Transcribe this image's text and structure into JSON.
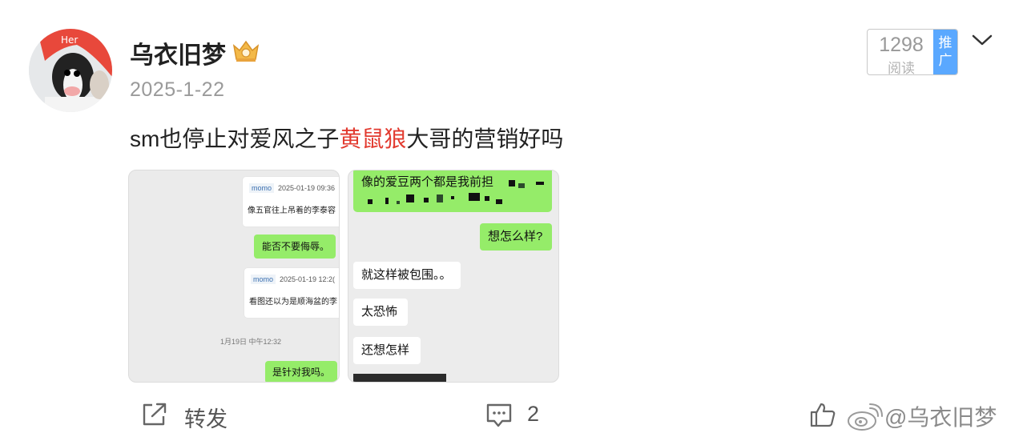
{
  "post": {
    "username": "乌衣旧梦",
    "date": "2025-1-22",
    "views": {
      "count": "1298",
      "label": "阅读",
      "promo": [
        "推",
        "广"
      ]
    },
    "text_before": "sm也停止对爱风之子",
    "text_highlight": "黄鼠狼",
    "text_after": "大哥的营销好吗",
    "highlight_color": "#e23a2f"
  },
  "image1": {
    "card1": {
      "user": "momo",
      "date": "2025-01-19 09:36",
      "text": "像五官往上吊着的李泰容"
    },
    "bubble1": "能否不要侮辱。",
    "card2": {
      "user": "momo",
      "date": "2025-01-19 12:2(",
      "text": "看图还以为是顺海盆的李"
    },
    "timestamp": "1月19日 中午12:32",
    "bubble2": "是针对我吗。"
  },
  "image2": {
    "bubble_top": "像的爱豆两个都是我前担",
    "bubble_right": "想怎么样?",
    "left_bubbles": [
      "就这样被包围。。",
      "太恐怖",
      "还想怎样"
    ]
  },
  "actions": {
    "repost_label": "转发",
    "comment_count": "2"
  },
  "watermark": "@乌衣旧梦",
  "colors": {
    "bubble_green": "#95ec69",
    "promo_blue": "#5aa8ff",
    "page_bg": "#ffffff"
  }
}
